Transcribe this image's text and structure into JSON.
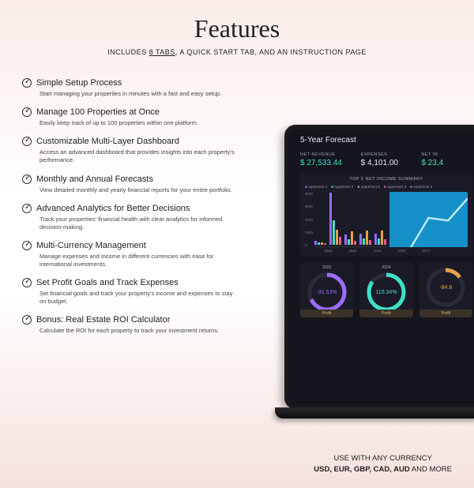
{
  "page": {
    "title": "Features",
    "subtitle_prefix": "INCLUDES ",
    "subtitle_tabs": "8 TABS",
    "subtitle_suffix": ", A QUICK START TAB, AND AN INSTRUCTION PAGE"
  },
  "features": [
    {
      "title": "Simple Setup Process",
      "desc": "Start managing your properties in minutes with a fast and easy setup."
    },
    {
      "title": "Manage 100 Properties at Once",
      "desc": "Easily keep track of up to 100 properties within one platform."
    },
    {
      "title": "Customizable Multi-Layer Dashboard",
      "desc": "Access an advanced dashboard that provides insights into each property's performance."
    },
    {
      "title": "Monthly and Annual Forecasts",
      "desc": "View detailed monthly and yearly financial reports for your entire portfolio."
    },
    {
      "title": "Advanced Analytics for Better Decisions",
      "desc": "Track your properties' financial health with clear analytics for informed decision-making."
    },
    {
      "title": "Multi-Currency Management",
      "desc": "Manage expenses and income in different currencies with ease for international investments."
    },
    {
      "title": "Set Profit Goals and Track Expenses",
      "desc": "Set financial goals and track your property's income and expenses to stay on budget."
    },
    {
      "title": "Bonus: Real Estate ROI Calculator",
      "desc": "Calculate the ROI for each property to track your investment returns."
    }
  ],
  "dashboard": {
    "title": "5-Year Forecast",
    "kpis": [
      {
        "label": "NET REVENUE",
        "value": "$ 27,533.44",
        "accent": true
      },
      {
        "label": "EXPENSES",
        "value": "$ 4,101.00",
        "accent": false
      },
      {
        "label": "NET IN",
        "value": "$ 23,4",
        "accent": true
      }
    ],
    "panel_title": "TOP 5 NET INCOME SUMMARY",
    "legend": [
      "Apartment 1",
      "Apartment 4",
      "Apartment 9",
      "Apartment 3",
      "Apartment 2"
    ],
    "donuts": [
      {
        "year": "2023",
        "value": "-31.53%",
        "color": "#9a6cff",
        "pct": 68
      },
      {
        "year": "2024",
        "value": "115.34%",
        "color": "#3de0c8",
        "pct": 85
      },
      {
        "year": "",
        "value": "-84.8",
        "color": "#e8a04a",
        "pct": 15
      }
    ],
    "donut_label": "Profit"
  },
  "chart_data": {
    "type": "bar",
    "title": "TOP 5 NET INCOME SUMMARY",
    "ylim": [
      0,
      8000
    ],
    "yticks": [
      8000,
      6000,
      4000,
      2000,
      0
    ],
    "categories": [
      "2023",
      "2024",
      "2025",
      "2026",
      "2027"
    ],
    "series": [
      {
        "name": "Apartment 1",
        "color": "#9a6cff",
        "values": [
          600,
          7800,
          1500,
          1600,
          1700
        ]
      },
      {
        "name": "Apartment 4",
        "color": "#3de0c8",
        "values": [
          400,
          3600,
          800,
          900,
          1000
        ]
      },
      {
        "name": "Apartment 9",
        "color": "#e8a04a",
        "values": [
          300,
          2200,
          2000,
          2100,
          2100
        ]
      },
      {
        "name": "Apartment 3",
        "color": "#e85a8a",
        "values": [
          200,
          1200,
          600,
          700,
          800
        ]
      }
    ]
  },
  "currency": {
    "line1": "USE WITH ANY CURRENCY",
    "b1": "USD, EUR, GBP, CAD, AUD",
    "suffix": " AND MORE"
  }
}
